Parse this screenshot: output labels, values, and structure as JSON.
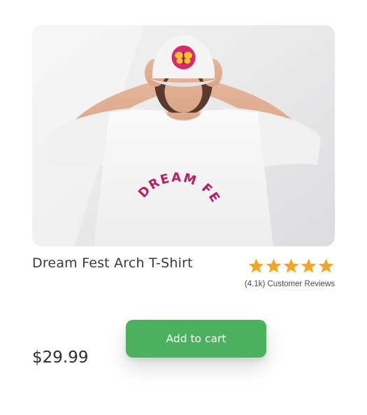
{
  "product": {
    "title": "Dream Fest Arch T-Shirt",
    "image": {
      "shirt_print": "DREAM FEST",
      "shirt_print_color": "#b81e62",
      "cap_badge_color": "#d8296f",
      "cap_badge_icon": "butterfly-icon"
    },
    "rating": {
      "stars": 5,
      "star_color": "#f2a623",
      "reviews_label": "(4.1k) Customer Reviews"
    },
    "price": "$29.99"
  },
  "actions": {
    "add_to_cart_label": "Add to cart",
    "accent_color": "#4cb15e"
  }
}
